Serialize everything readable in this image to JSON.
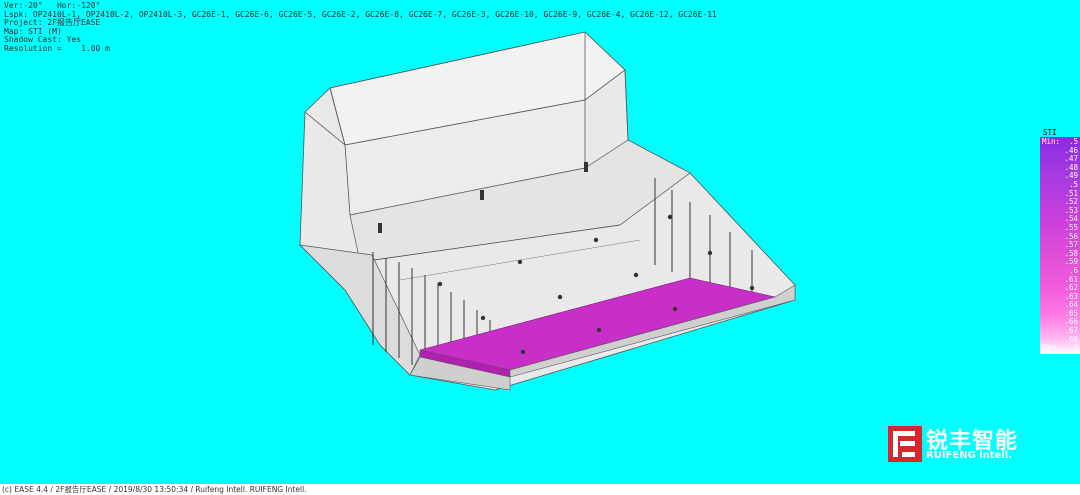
{
  "header": {
    "lines": [
      "Ver:-20°   Hor:-120°",
      "Lspk: OP2410L-1, OP2410L-2, OP2410L-3, GC26E-1, GC26E-6, GC26E-5, GC26E-2, GC26E-8, GC26E-7, GC26E-3, GC26E-10, GC26E-9, GC26E-4, GC26E-12, GC26E-11",
      "Project: 2F报告厅EASE",
      "Map: STI (M)",
      "Shadow Cast: Yes",
      "Resolution =    1.00 m"
    ]
  },
  "legend": {
    "title": "STI",
    "rows": [
      {
        "label": "Min:",
        "value": ".5"
      },
      {
        "label": "",
        "value": ".46"
      },
      {
        "label": "",
        "value": ".47"
      },
      {
        "label": "",
        "value": ".48"
      },
      {
        "label": "",
        "value": ".49"
      },
      {
        "label": "",
        "value": ".5"
      },
      {
        "label": "",
        "value": ".51"
      },
      {
        "label": "",
        "value": ".52"
      },
      {
        "label": "",
        "value": ".53"
      },
      {
        "label": "",
        "value": ".54"
      },
      {
        "label": "",
        "value": ".55"
      },
      {
        "label": "",
        "value": ".56"
      },
      {
        "label": "",
        "value": ".57"
      },
      {
        "label": "",
        "value": ".58"
      },
      {
        "label": "",
        "value": ".59"
      },
      {
        "label": "",
        "value": ".6"
      },
      {
        "label": "",
        "value": ".61"
      },
      {
        "label": "",
        "value": ".62"
      },
      {
        "label": "",
        "value": ".63"
      },
      {
        "label": "",
        "value": ".64"
      },
      {
        "label": "",
        "value": ".65"
      },
      {
        "label": "",
        "value": ".66"
      },
      {
        "label": "",
        "value": ".67"
      },
      {
        "label": "",
        "value": ".68"
      },
      {
        "label": "Max:",
        "value": ".6"
      }
    ]
  },
  "logo": {
    "cn": "锐丰智能",
    "en": "RUIFENG intell."
  },
  "footer": {
    "status": "(c) EASE 4.4  / 2F报告厅EASE  / 2019/8/30 13:50:34 / Ruifeng Intell. RUIFENG Intell."
  },
  "colors": {
    "background": "#00ffff",
    "map_fill": "#c82fc8",
    "model_fill": "#e8e8e8",
    "logo_red": "#d8262e"
  }
}
